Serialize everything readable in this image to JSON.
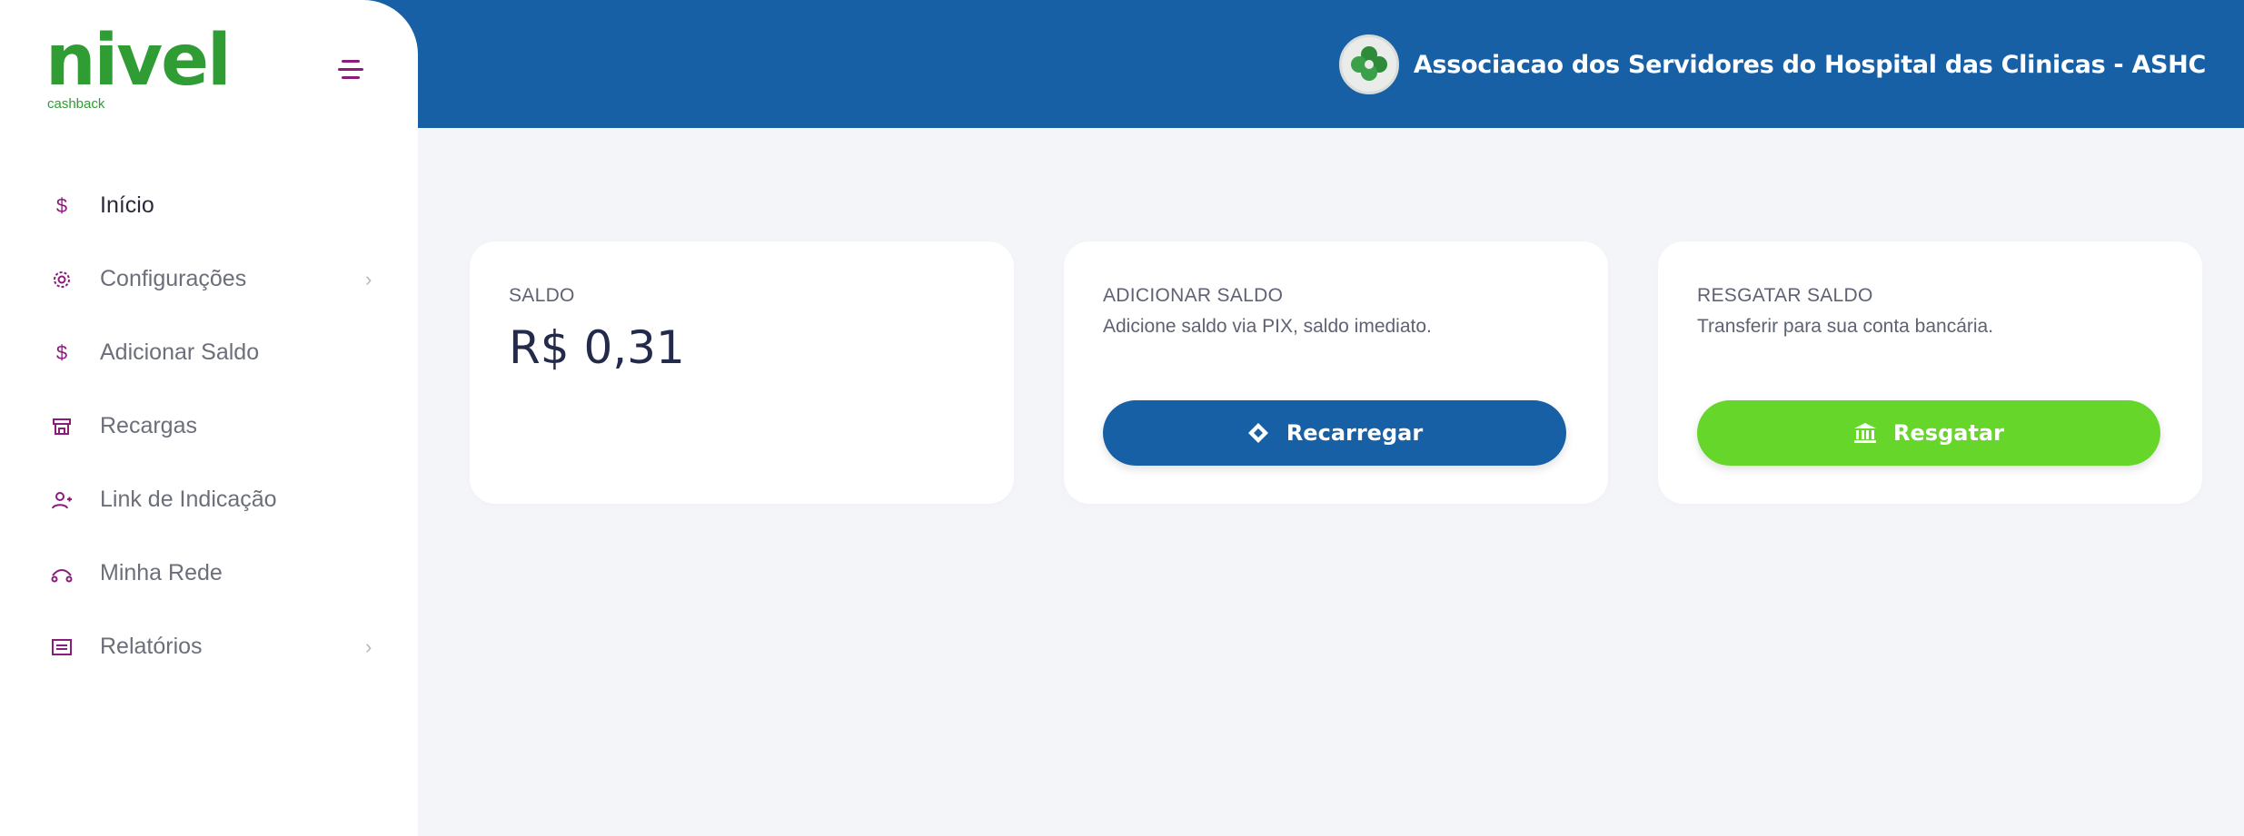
{
  "brand": {
    "name": "nivel",
    "tagline": "cashback"
  },
  "header": {
    "org_name": "Associacao dos Servidores do Hospital das Clinicas - ASHC"
  },
  "sidebar": {
    "items": [
      {
        "label": "Início",
        "icon": "dollar-icon"
      },
      {
        "label": "Configurações",
        "icon": "gear-icon",
        "has_submenu": true
      },
      {
        "label": "Adicionar Saldo",
        "icon": "dollar-icon"
      },
      {
        "label": "Recargas",
        "icon": "store-icon"
      },
      {
        "label": "Link de Indicação",
        "icon": "user-add-icon"
      },
      {
        "label": "Minha Rede",
        "icon": "network-icon"
      },
      {
        "label": "Relatórios",
        "icon": "report-icon",
        "has_submenu": true
      }
    ]
  },
  "cards": {
    "balance": {
      "title": "SALDO",
      "value": "R$ 0,31"
    },
    "add": {
      "title": "ADICIONAR SALDO",
      "subtitle": "Adicione saldo via PIX, saldo imediato.",
      "button": "Recarregar"
    },
    "withdraw": {
      "title": "RESGATAR SALDO",
      "subtitle": "Transferir para sua conta bancária.",
      "button": "Resgatar"
    }
  },
  "colors": {
    "header": "#1760a5",
    "accent": "#8a1d7c",
    "brand": "#2f9c34",
    "success": "#66d62a"
  }
}
